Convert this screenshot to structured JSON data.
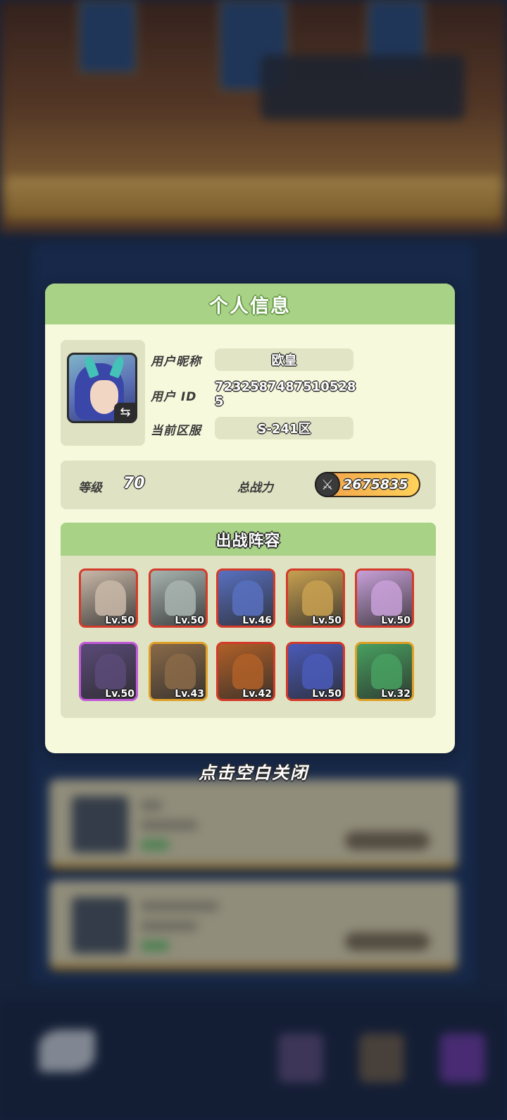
{
  "modal": {
    "title": "个人信息",
    "nickname_label": "用户昵称",
    "nickname": "欧皇",
    "user_id_label": "用户 ID",
    "user_id": "7232587487510528​5",
    "server_label": "当前区服",
    "server": "S-241区",
    "level_label": "等级",
    "level": "70",
    "power_label": "总战力",
    "power": "2675835"
  },
  "lineup": {
    "title": "出战阵容",
    "heroes": [
      {
        "level": "Lv.50",
        "rarity": "red",
        "color": "#c9b8a8"
      },
      {
        "level": "Lv.50",
        "rarity": "red",
        "color": "#a8b4b0"
      },
      {
        "level": "Lv.46",
        "rarity": "red",
        "color": "#5870c0"
      },
      {
        "level": "Lv.50",
        "rarity": "red",
        "color": "#c8a050"
      },
      {
        "level": "Lv.50",
        "rarity": "red",
        "color": "#c8a0d8"
      },
      {
        "level": "Lv.50",
        "rarity": "purple",
        "color": "#5a4a78"
      },
      {
        "level": "Lv.43",
        "rarity": "gold",
        "color": "#8a6a48"
      },
      {
        "level": "Lv.42",
        "rarity": "red",
        "color": "#b06028"
      },
      {
        "level": "Lv.50",
        "rarity": "red",
        "color": "#4a5ab8"
      },
      {
        "level": "Lv.32",
        "rarity": "gold",
        "color": "#48a060"
      }
    ]
  },
  "close_hint": "点击空白关闭"
}
